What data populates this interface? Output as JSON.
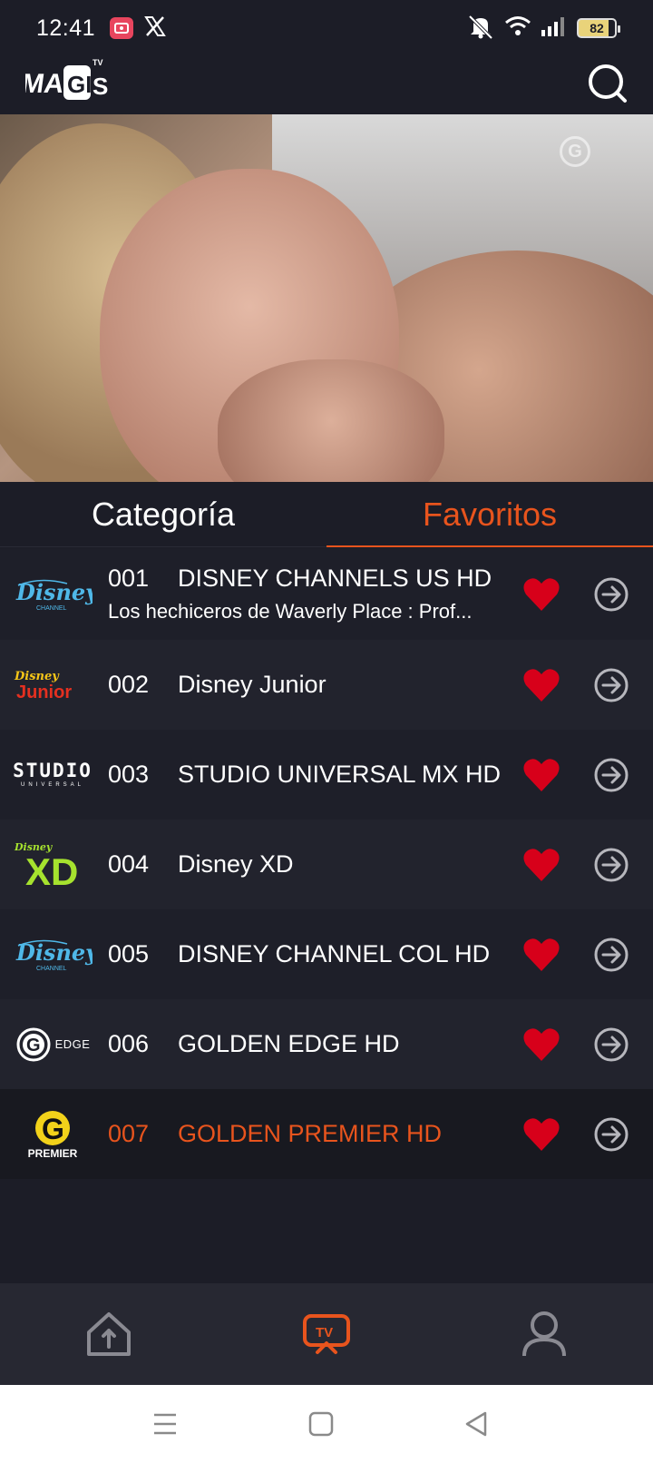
{
  "status_bar": {
    "time": "12:41",
    "battery": "82",
    "icons": [
      "screen-record-icon",
      "x-app-icon",
      "mute-icon",
      "wifi-icon",
      "signal-icon",
      "battery-icon"
    ]
  },
  "header": {
    "logo_text": "MAGIS TV",
    "search_icon": "search-icon"
  },
  "tabs": [
    {
      "label": "Categoría",
      "active": false
    },
    {
      "label": "Favoritos",
      "active": true
    }
  ],
  "channels": [
    {
      "number": "001",
      "name": "DISNEY CHANNELS US HD",
      "subtitle": "Los hechiceros de Waverly Place : Prof...",
      "logo": "disney-channel-logo",
      "favorite": true,
      "selected": false
    },
    {
      "number": "002",
      "name": "Disney Junior",
      "logo": "disney-junior-logo",
      "favorite": true,
      "selected": false
    },
    {
      "number": "003",
      "name": "STUDIO UNIVERSAL MX HD",
      "logo": "studio-universal-logo",
      "logo_text": "STUDIO",
      "logo_subtext": "UNIVERSAL",
      "favorite": true,
      "selected": false
    },
    {
      "number": "004",
      "name": "Disney XD",
      "logo": "disney-xd-logo",
      "favorite": true,
      "selected": false
    },
    {
      "number": "005",
      "name": "DISNEY CHANNEL COL HD",
      "logo": "disney-channel-logo",
      "favorite": true,
      "selected": false
    },
    {
      "number": "006",
      "name": "GOLDEN EDGE HD",
      "logo": "golden-edge-logo",
      "logo_text": "EDGE",
      "favorite": true,
      "selected": false
    },
    {
      "number": "007",
      "name": "GOLDEN PREMIER HD",
      "logo": "golden-premier-logo",
      "logo_text": "PREMIER",
      "favorite": true,
      "selected": true
    }
  ],
  "bottom_nav": [
    {
      "name": "home",
      "icon": "home-icon",
      "active": false
    },
    {
      "name": "tv",
      "icon": "tv-icon",
      "label": "TV",
      "active": true
    },
    {
      "name": "profile",
      "icon": "user-icon",
      "active": false
    }
  ],
  "colors": {
    "accent": "#e8541d",
    "background": "#1c1d27",
    "heart": "#d7001a"
  }
}
